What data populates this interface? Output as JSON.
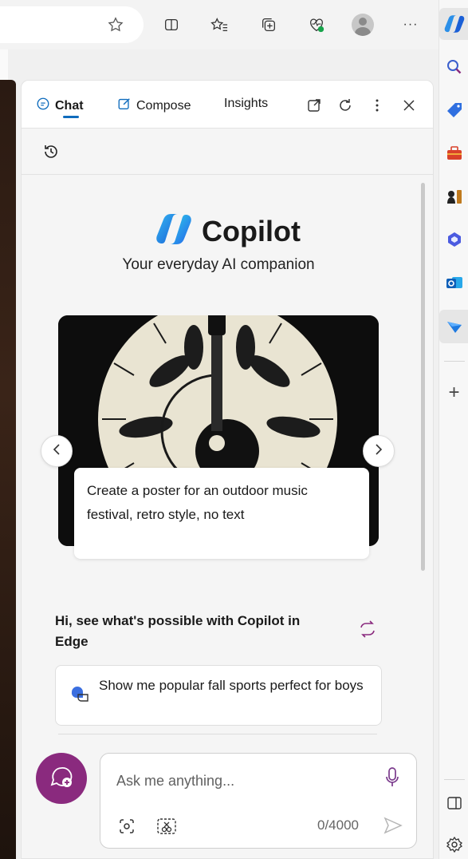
{
  "toolbar": {
    "icons": [
      "favorite-star-icon",
      "split-screen-icon",
      "favorites-icon",
      "collections-icon",
      "browser-essentials-icon",
      "profile-avatar",
      "more-options-icon",
      "copilot-icon"
    ],
    "more_label": "···"
  },
  "tabs": [
    {
      "label": "Chat",
      "icon": "chat-icon",
      "active": true
    },
    {
      "label": "Compose",
      "icon": "compose-icon",
      "active": false
    },
    {
      "label": "Insights",
      "icon": "",
      "active": false
    }
  ],
  "header_actions": [
    "open-in-new-icon",
    "refresh-icon",
    "more-vert-icon",
    "close-icon"
  ],
  "brand": {
    "title": "Copilot",
    "tagline": "Your everyday AI companion"
  },
  "carousel": {
    "prompt": "Create a poster for an outdoor music festival, retro style, no text"
  },
  "suggestions": {
    "heading": "Hi, see what's possible with Copilot in Edge",
    "items": [
      {
        "text": "Show me popular fall sports perfect for boys"
      }
    ]
  },
  "input": {
    "placeholder": "Ask me anything...",
    "counter": "0/4000"
  },
  "sidebar": {
    "items": [
      "search-icon",
      "shopping-tag-icon",
      "tools-icon",
      "games-icon",
      "microsoft-365-icon",
      "outlook-icon",
      "drop-icon"
    ],
    "add_label": "+"
  },
  "colors": {
    "accent": "#0f6cbd",
    "new_topic": "#8a2a7e",
    "mic": "#7a3a8c"
  }
}
